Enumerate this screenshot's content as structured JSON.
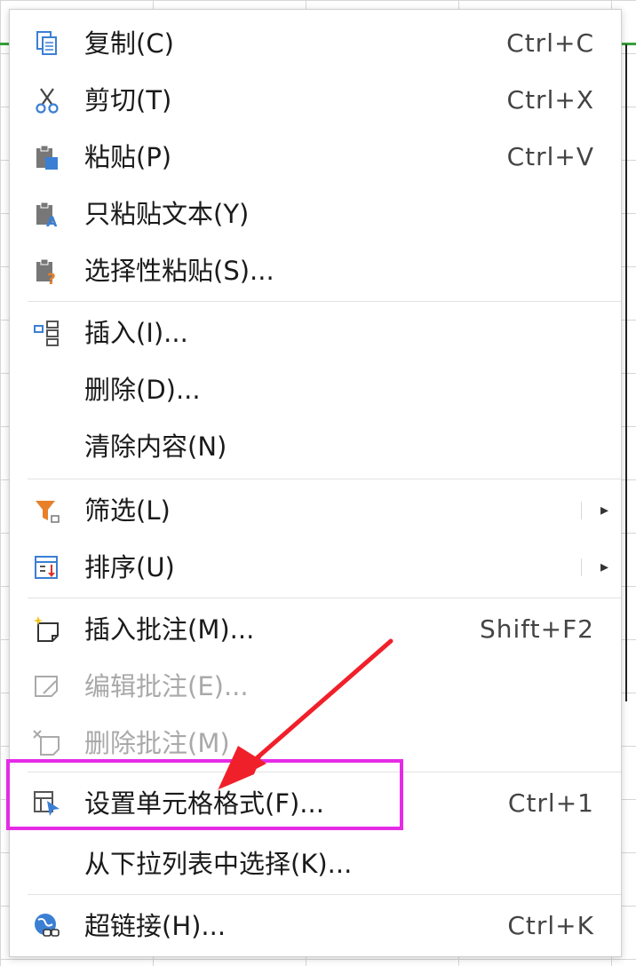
{
  "menu": {
    "items": [
      {
        "label": "复制(C)",
        "shortcut": "Ctrl+C",
        "icon": "copy-icon"
      },
      {
        "label": "剪切(T)",
        "shortcut": "Ctrl+X",
        "icon": "scissors-icon"
      },
      {
        "label": "粘贴(P)",
        "shortcut": "Ctrl+V",
        "icon": "paste-icon"
      },
      {
        "label": "只粘贴文本(Y)",
        "shortcut": "",
        "icon": "paste-text-icon"
      },
      {
        "label": "选择性粘贴(S)...",
        "shortcut": "",
        "icon": "paste-special-icon"
      },
      {
        "label": "插入(I)...",
        "shortcut": "",
        "icon": "insert-icon"
      },
      {
        "label": "删除(D)...",
        "shortcut": "",
        "icon": ""
      },
      {
        "label": "清除内容(N)",
        "shortcut": "",
        "icon": ""
      },
      {
        "label": "筛选(L)",
        "shortcut": "",
        "icon": "filter-icon",
        "submenu": true
      },
      {
        "label": "排序(U)",
        "shortcut": "",
        "icon": "sort-icon",
        "submenu": true
      },
      {
        "label": "插入批注(M)...",
        "shortcut": "Shift+F2",
        "icon": "insert-comment-icon"
      },
      {
        "label": "编辑批注(E)...",
        "shortcut": "",
        "icon": "edit-comment-icon",
        "disabled": true
      },
      {
        "label": "删除批注(M)",
        "shortcut": "",
        "icon": "delete-comment-icon",
        "disabled": true
      },
      {
        "label": "设置单元格格式(F)...",
        "shortcut": "Ctrl+1",
        "icon": "format-cells-icon",
        "highlighted": true
      },
      {
        "label": "从下拉列表中选择(K)...",
        "shortcut": "",
        "icon": ""
      },
      {
        "label": "超链接(H)...",
        "shortcut": "Ctrl+K",
        "icon": "hyperlink-icon"
      }
    ],
    "submenu_arrow": "▸"
  },
  "colors": {
    "highlight_box": "#e52be6",
    "annotation_arrow": "#f0202a",
    "sheet_green": "#36a13a",
    "icon_blue": "#3b7fd4",
    "icon_orange": "#e8802a"
  }
}
